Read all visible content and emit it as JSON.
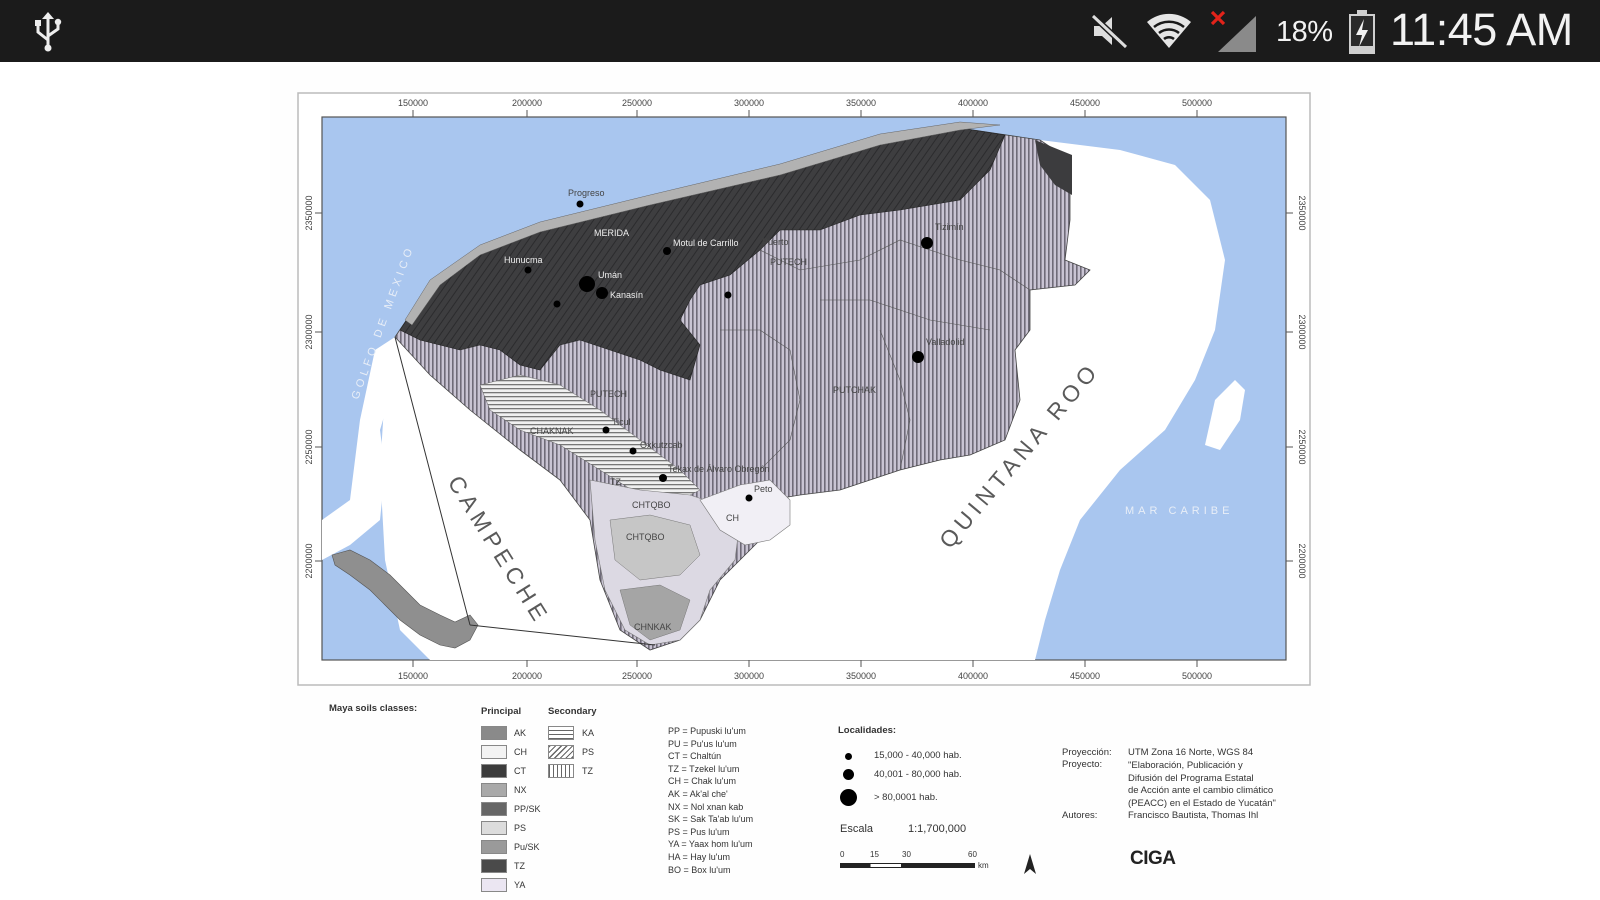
{
  "status_bar": {
    "battery_percent": "18%",
    "time": "11:45 AM",
    "icons": [
      "usb-icon",
      "mute-icon",
      "wifi-icon",
      "no-signal-icon",
      "battery-charging-icon"
    ]
  },
  "map": {
    "top_ticks": [
      "150000",
      "200000",
      "250000",
      "300000",
      "350000",
      "400000",
      "450000",
      "500000"
    ],
    "bottom_ticks": [
      "150000",
      "200000",
      "250000",
      "300000",
      "350000",
      "400000",
      "450000",
      "500000"
    ],
    "left_ticks": [
      "2350000",
      "2300000",
      "2250000",
      "2200000"
    ],
    "right_ticks": [
      "2350000",
      "2300000",
      "2250000",
      "2200000"
    ],
    "sea_labels": {
      "gulf": "GOLFO DE MEXICO",
      "caribbean": "MAR CARIBE"
    },
    "region_labels": {
      "campeche": "CAMPECHE",
      "quintana_roo": "QUINTANA ROO"
    },
    "places": {
      "progreso": "Progreso",
      "merida": "MERIDA",
      "hunucma": "Hunucma",
      "motul": "Motul de Carrillo",
      "puerto": "Puerto",
      "putech_n": "PUTECH",
      "tizimin": "Tizimín",
      "valladolid": "Valladolid",
      "umán": "Umán",
      "kanasin": "Kanasín",
      "putech_s": "PUTECH",
      "putchak": "PUTCHAK",
      "ticul": "Ticul",
      "chaknak": "CHAKNAK",
      "oxkutzcab": "Oxkutzcab",
      "tekax": "Tekax de Álvaro Obregón",
      "peto": "Peto",
      "ch": "CH",
      "ckt1": "CHTQBO",
      "ckt2": "CHTQBO",
      "bottom": "CHNKAK",
      "tz": "TZ"
    }
  },
  "legend": {
    "soils_title": "Maya soils classes:",
    "principal_title": "Principal",
    "secondary_title": "Secondary",
    "principal": [
      {
        "code": "AK",
        "color": "#8a8a8a"
      },
      {
        "code": "CH",
        "color": "#f3f3f3"
      },
      {
        "code": "CT",
        "color": "#3c3c3c"
      },
      {
        "code": "NX",
        "color": "#a9a9a9"
      },
      {
        "code": "PP/SK",
        "color": "#666666"
      },
      {
        "code": "PS",
        "color": "#dcdcdc"
      },
      {
        "code": "Pu/SK",
        "color": "#9a9a9a"
      },
      {
        "code": "TZ",
        "color": "#4a4a4a"
      },
      {
        "code": "YA",
        "color": "#ebe6f2"
      }
    ],
    "secondary": [
      {
        "code": "KA",
        "pattern": "horizontal"
      },
      {
        "code": "PS",
        "pattern": "diagonal"
      },
      {
        "code": "TZ",
        "pattern": "vertical"
      }
    ],
    "codes": [
      "PP = Pupuski lu'um",
      "PU = Pu'us lu'um",
      "CT = Chaltún",
      "TZ = Tzekel lu'um",
      "CH = Chak lu'um",
      "AK = Ak'al che'",
      "NX = Nol xnan kab",
      "SK = Sak Ta'ab lu'um",
      "PS = Pus lu'um",
      "YA = Yaax hom lu'um",
      "HA = Hay lu'um",
      "BO = Box lu'um"
    ],
    "localities_title": "Localidades:",
    "localities": [
      "15,000 - 40,000 hab.",
      "40,001 - 80,000 hab.",
      "> 80,0001 hab."
    ],
    "scale_label": "Escala",
    "scale_value": "1:1,700,000",
    "scale_ticks": [
      "0",
      "15",
      "30",
      "60"
    ],
    "scale_unit": "km",
    "projection_label": "Proyección:",
    "projection_value": "UTM Zona 16 Norte, WGS 84",
    "project_label": "Proyecto:",
    "project_value": [
      "\"Elaboración, Publicación y",
      "Difusión del Programa Estatal",
      "de Acción ante el cambio climático",
      "(PEACC) en el Estado de Yucatán\""
    ],
    "authors_label": "Autores:",
    "authors_value": "Francisco Bautista, Thomas Ihl",
    "logo": "CIGA"
  }
}
